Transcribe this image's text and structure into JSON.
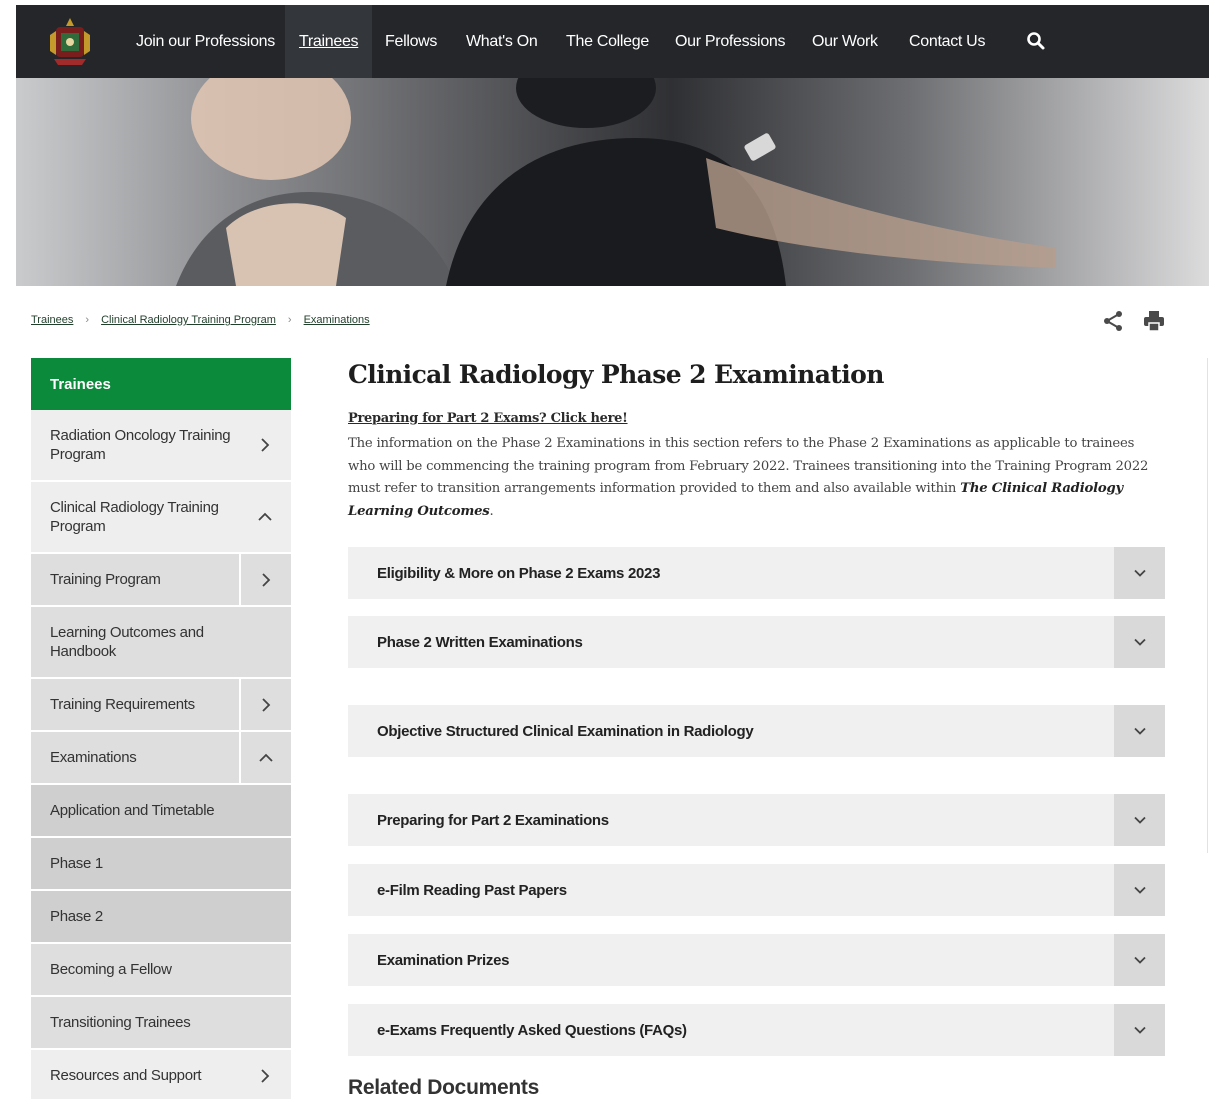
{
  "nav": {
    "items": [
      {
        "label": "Join our Professions",
        "active": false
      },
      {
        "label": "Trainees",
        "active": true
      },
      {
        "label": "Fellows",
        "active": false
      },
      {
        "label": "What's On",
        "active": false
      },
      {
        "label": "The College",
        "active": false
      },
      {
        "label": "Our Professions",
        "active": false
      },
      {
        "label": "Our Work",
        "active": false
      },
      {
        "label": "Contact Us",
        "active": false
      }
    ]
  },
  "breadcrumb": [
    "Trainees",
    "Clinical Radiology Training Program",
    "Examinations"
  ],
  "sidebar": {
    "heading": "Trainees",
    "items": [
      {
        "label": "Radiation Oncology Training Program",
        "level": 0,
        "chevron": "right"
      },
      {
        "label": "Clinical Radiology Training Program",
        "level": 0,
        "chevron": "up"
      },
      {
        "label": "Training Program",
        "level": 1,
        "chevron": "right"
      },
      {
        "label": "Learning Outcomes and Handbook",
        "level": 1,
        "chevron": ""
      },
      {
        "label": "Training Requirements",
        "level": 1,
        "chevron": "right"
      },
      {
        "label": "Examinations",
        "level": 1,
        "chevron": "up"
      },
      {
        "label": "Application and Timetable",
        "level": 2,
        "chevron": ""
      },
      {
        "label": "Phase 1",
        "level": 2,
        "chevron": ""
      },
      {
        "label": "Phase 2",
        "level": 2,
        "chevron": ""
      },
      {
        "label": "Becoming a Fellow",
        "level": 1,
        "chevron": ""
      },
      {
        "label": "Transitioning Trainees",
        "level": 1,
        "chevron": ""
      },
      {
        "label": "Resources and Support",
        "level": 0,
        "chevron": "right"
      }
    ]
  },
  "main": {
    "title": "Clinical Radiology Phase 2 Examination",
    "intro_link": "Preparing for Part 2 Exams? Click here!",
    "intro_text": "The information on the Phase 2 Examinations in this section refers to the Phase 2 Examinations as applicable to trainees who will be commencing the training program from February 2022. Trainees transitioning into the Training Program 2022 must refer to transition arrangements information provided to them and also available within ",
    "intro_emphasis": "The Clinical Radiology Learning Outcomes",
    "intro_end": ".",
    "accordions": [
      "Eligibility & More on Phase 2 Exams 2023",
      "Phase 2 Written Examinations",
      "Objective Structured Clinical Examination in Radiology",
      "Preparing for Part 2 Examinations",
      "e-Film Reading Past Papers",
      "Examination Prizes",
      "e-Exams Frequently Asked Questions (FAQs)"
    ],
    "related_title": "Related Documents"
  },
  "colors": {
    "nav_bg": "#24262a",
    "accent_green": "#0a8a3a",
    "sidebar_bg": "#eeeeee",
    "accordion_bg": "#f0f0f0",
    "toggle_bg": "#d9d9d9"
  },
  "icons": [
    "college-crest-logo",
    "search-icon",
    "share-icon",
    "print-icon",
    "chevron-right-icon",
    "chevron-up-icon",
    "chevron-down-icon"
  ]
}
